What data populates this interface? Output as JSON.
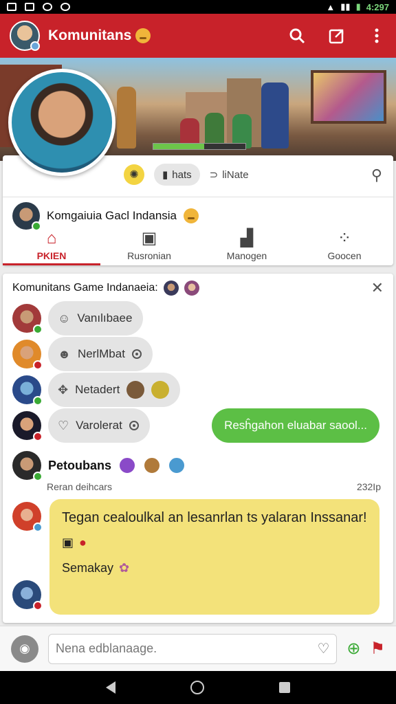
{
  "status_bar": {
    "time": "4:297"
  },
  "app_bar": {
    "title": "Komunitans",
    "icons": [
      "search-icon",
      "share-icon",
      "more-vertical-icon"
    ]
  },
  "profile": {
    "chips": {
      "bug_icon": "bug-icon",
      "chat_label": "hats",
      "rate_label": "liNate"
    },
    "group_name": "Komgaiuia Gacl Indansia"
  },
  "tabs": [
    {
      "label": "PKIEN",
      "icon": "home-icon",
      "active": true
    },
    {
      "label": "Rusronian",
      "icon": "trash-icon",
      "active": false
    },
    {
      "label": "Manogen",
      "icon": "thumbs-up-icon",
      "active": false
    },
    {
      "label": "Goocen",
      "icon": "grid-icon",
      "active": false
    }
  ],
  "chat": {
    "header": "Komunitans Game Indanaeia:",
    "messages": [
      {
        "label": "Vanılıbaee",
        "icon": "user-icon"
      },
      {
        "label": "NerlMbat",
        "icon": "user-icon"
      },
      {
        "label": "Netadert",
        "icon": "gamepad-icon"
      },
      {
        "label": "Varolerat",
        "icon": "heart-icon"
      }
    ],
    "outgoing": "Resĥgahon eluabar saool...",
    "post": {
      "author": "Petoubans",
      "subtitle": "Reran deihcars",
      "time": "232Ip",
      "text": "Tegan cealoulkal an lesanrlan ts yalaran Inssanar!",
      "footer": "Semakay"
    }
  },
  "compose": {
    "placeholder": "Nena edblanaage."
  },
  "colors": {
    "primary": "#c8222a",
    "green_bubble": "#5cbf45",
    "yellow_bubble": "#f3e27a"
  }
}
